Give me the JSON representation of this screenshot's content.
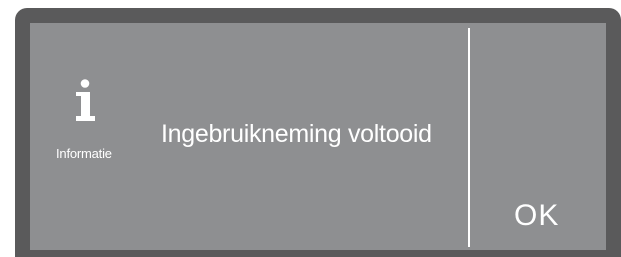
{
  "dialog": {
    "icon": "info-icon",
    "icon_caption": "Informatie",
    "message": "Ingebruikneming voltooid",
    "ok_label": "OK"
  },
  "colors": {
    "bezel": "#5a5a5b",
    "screen": "#8e8f91",
    "text": "#ffffff"
  }
}
